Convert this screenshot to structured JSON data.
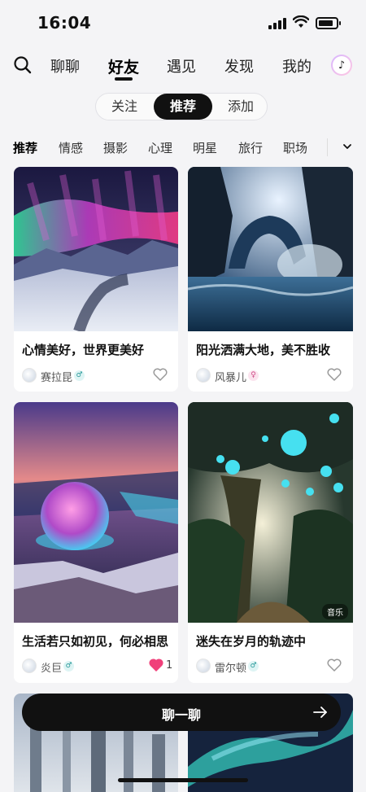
{
  "status_bar": {
    "time": "16:04",
    "icons": [
      "signal-icon",
      "wifi-icon",
      "battery-icon"
    ]
  },
  "top_nav": {
    "tabs": [
      "聊聊",
      "好友",
      "遇见",
      "发现",
      "我的"
    ],
    "active_tab": "好友",
    "icons": [
      "search-icon",
      "music-icon"
    ]
  },
  "segment": {
    "items": [
      "关注",
      "推荐",
      "添加"
    ],
    "active": "推荐"
  },
  "categories": {
    "items": [
      "推荐",
      "情感",
      "摄影",
      "心理",
      "明星",
      "旅行",
      "职场"
    ],
    "active": "推荐",
    "more_icon": "chevron-down-icon"
  },
  "cards": [
    {
      "title": "心情美好，世界更美好",
      "author": "赛拉昆",
      "gender": "♂",
      "liked": false,
      "likes": ""
    },
    {
      "title": "阳光洒满大地，美不胜收",
      "author": "风暴儿",
      "gender": "♀",
      "liked": false,
      "likes": ""
    },
    {
      "title": "生活若只如初见，何必相思",
      "author": "炎巨",
      "gender": "♂",
      "liked": true,
      "likes": "1"
    },
    {
      "title": "迷失在岁月的轨迹中",
      "author": "雷尔顿",
      "gender": "♂",
      "liked": false,
      "likes": "",
      "tag": "音乐"
    }
  ],
  "chat_button": {
    "label": "聊一聊",
    "icon": "arrow-right-icon"
  },
  "colors": {
    "background": "#f4f4f6",
    "accent_dark": "#111111",
    "like_pink": "#f0407a"
  }
}
